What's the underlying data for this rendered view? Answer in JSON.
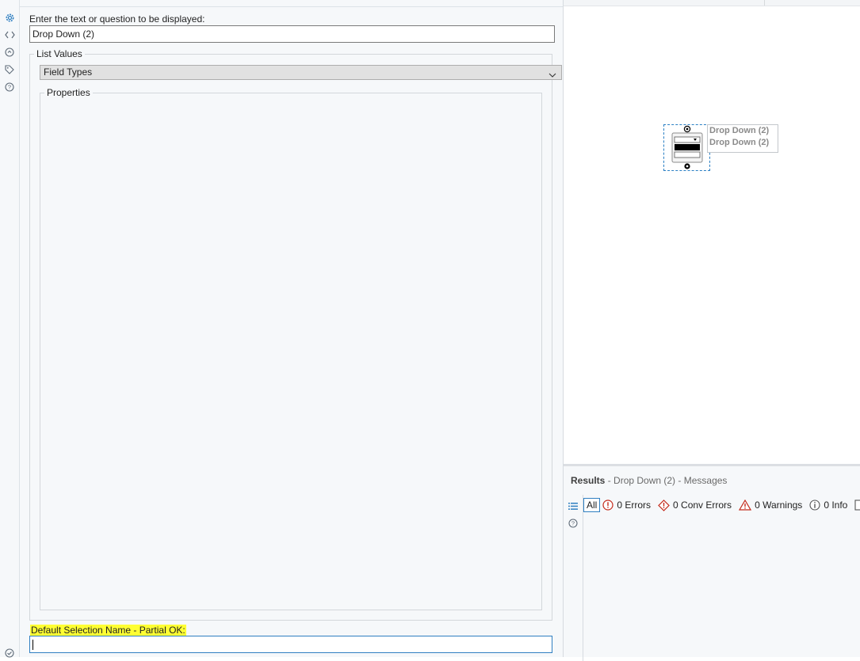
{
  "config": {
    "prompt_label": "Enter the text or question to be displayed:",
    "prompt_value": "Drop Down (2)",
    "list_values_legend": "List Values",
    "list_values_selected": "Field Types",
    "properties_legend": "Properties",
    "default_selection_label": "Default Selection Name - Partial OK:",
    "default_selection_value": ""
  },
  "left_rail": {
    "icons": [
      "gear-icon",
      "code-icon",
      "annotation-icon",
      "tag-icon",
      "help-icon",
      "check-circle-icon"
    ]
  },
  "canvas": {
    "tool_annotation_line1": "Drop Down (2)",
    "tool_annotation_line2": "Drop Down (2)"
  },
  "results": {
    "title": "Results",
    "subtitle": "- Drop Down (2) - Messages",
    "filters": {
      "all": "All",
      "errors": "0 Errors",
      "conv_errors": "0 Conv Errors",
      "warnings": "0 Warnings",
      "info": "0 Info"
    }
  },
  "colors": {
    "accent": "#2f7fc1",
    "highlight": "#ffff33",
    "error": "#c42b1c",
    "warning": "#c42b1c",
    "panel_bg": "#f6f8fa"
  }
}
